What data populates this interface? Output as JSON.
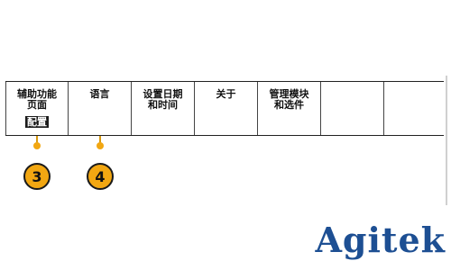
{
  "menu": {
    "items": [
      {
        "lines": [
          "辅助功能",
          "页面"
        ],
        "value": "配置"
      },
      {
        "lines": [
          "语言"
        ]
      },
      {
        "lines": [
          "设置日期",
          "和时间"
        ]
      },
      {
        "lines": [
          "关于"
        ]
      },
      {
        "lines": [
          "管理模块",
          "和选件"
        ]
      },
      {
        "lines": []
      },
      {
        "lines": []
      }
    ]
  },
  "callouts": [
    {
      "number": "3"
    },
    {
      "number": "4"
    }
  ],
  "brand": {
    "logo_text": "Agitek"
  },
  "colors": {
    "callout": "#f2a712",
    "brand": "#1d4f93"
  }
}
